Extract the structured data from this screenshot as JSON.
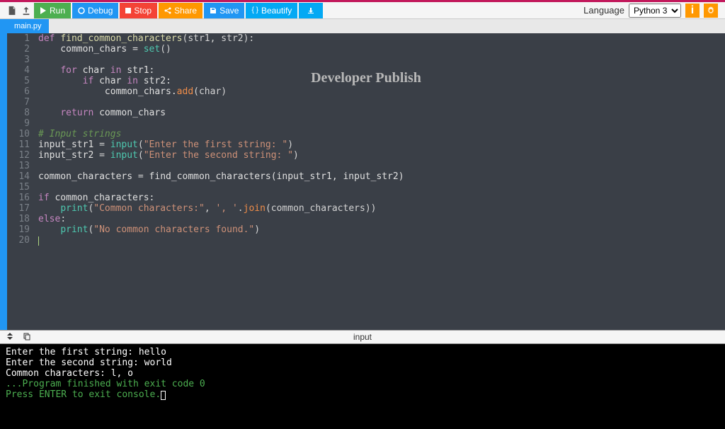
{
  "toolbar": {
    "run": "Run",
    "debug": "Debug",
    "stop": "Stop",
    "share": "Share",
    "save": "Save",
    "beautify": "Beautify"
  },
  "language": {
    "label": "Language",
    "selected": "Python 3"
  },
  "tab": {
    "name": "main.py"
  },
  "watermark": "Developer Publish",
  "code": {
    "lines": [
      [
        {
          "t": "def ",
          "c": "kw"
        },
        {
          "t": "find_common_characters",
          "c": "fn"
        },
        {
          "t": "(str1, str2):",
          "c": "op"
        }
      ],
      [
        {
          "t": "    common_chars ",
          "c": "var"
        },
        {
          "t": "=",
          "c": "op"
        },
        {
          "t": " ",
          "c": "op"
        },
        {
          "t": "set",
          "c": "fn2"
        },
        {
          "t": "()",
          "c": "op"
        }
      ],
      [
        {
          "t": "",
          "c": "op"
        }
      ],
      [
        {
          "t": "    ",
          "c": "op"
        },
        {
          "t": "for",
          "c": "kw"
        },
        {
          "t": " char ",
          "c": "var"
        },
        {
          "t": "in",
          "c": "kw"
        },
        {
          "t": " str1:",
          "c": "var"
        }
      ],
      [
        {
          "t": "        ",
          "c": "op"
        },
        {
          "t": "if",
          "c": "kw"
        },
        {
          "t": " char ",
          "c": "var"
        },
        {
          "t": "in",
          "c": "kw"
        },
        {
          "t": " str2:",
          "c": "var"
        }
      ],
      [
        {
          "t": "            common_chars.",
          "c": "var"
        },
        {
          "t": "add",
          "c": "call"
        },
        {
          "t": "(char)",
          "c": "op"
        }
      ],
      [
        {
          "t": "",
          "c": "op"
        }
      ],
      [
        {
          "t": "    ",
          "c": "op"
        },
        {
          "t": "return",
          "c": "kw"
        },
        {
          "t": " common_chars",
          "c": "var"
        }
      ],
      [
        {
          "t": "",
          "c": "op"
        }
      ],
      [
        {
          "t": "# Input strings",
          "c": "cmt"
        }
      ],
      [
        {
          "t": "input_str1 ",
          "c": "var"
        },
        {
          "t": "=",
          "c": "op"
        },
        {
          "t": " ",
          "c": "op"
        },
        {
          "t": "input",
          "c": "fn2"
        },
        {
          "t": "(",
          "c": "op"
        },
        {
          "t": "\"Enter the first string: \"",
          "c": "str"
        },
        {
          "t": ")",
          "c": "op"
        }
      ],
      [
        {
          "t": "input_str2 ",
          "c": "var"
        },
        {
          "t": "=",
          "c": "op"
        },
        {
          "t": " ",
          "c": "op"
        },
        {
          "t": "input",
          "c": "fn2"
        },
        {
          "t": "(",
          "c": "op"
        },
        {
          "t": "\"Enter the second string: \"",
          "c": "str"
        },
        {
          "t": ")",
          "c": "op"
        }
      ],
      [
        {
          "t": "",
          "c": "op"
        }
      ],
      [
        {
          "t": "common_characters ",
          "c": "var"
        },
        {
          "t": "=",
          "c": "op"
        },
        {
          "t": " find_common_characters(input_str1, input_str2)",
          "c": "var"
        }
      ],
      [
        {
          "t": "",
          "c": "op"
        }
      ],
      [
        {
          "t": "if",
          "c": "kw"
        },
        {
          "t": " common_characters:",
          "c": "var"
        }
      ],
      [
        {
          "t": "    ",
          "c": "op"
        },
        {
          "t": "print",
          "c": "fn2"
        },
        {
          "t": "(",
          "c": "op"
        },
        {
          "t": "\"Common characters:\"",
          "c": "str"
        },
        {
          "t": ", ",
          "c": "op"
        },
        {
          "t": "', '",
          "c": "str"
        },
        {
          "t": ".",
          "c": "op"
        },
        {
          "t": "join",
          "c": "call"
        },
        {
          "t": "(common_characters))",
          "c": "op"
        }
      ],
      [
        {
          "t": "else",
          "c": "kw"
        },
        {
          "t": ":",
          "c": "op"
        }
      ],
      [
        {
          "t": "    ",
          "c": "op"
        },
        {
          "t": "print",
          "c": "fn2"
        },
        {
          "t": "(",
          "c": "op"
        },
        {
          "t": "\"No common characters found.\"",
          "c": "str"
        },
        {
          "t": ")",
          "c": "op"
        }
      ],
      [
        {
          "t": "",
          "c": "op"
        }
      ]
    ]
  },
  "console_label": "input",
  "console": {
    "lines": [
      {
        "text": "Enter the first string: hello",
        "class": ""
      },
      {
        "text": "Enter the second string: world",
        "class": ""
      },
      {
        "text": "Common characters: l, o",
        "class": ""
      },
      {
        "text": "",
        "class": ""
      },
      {
        "text": "",
        "class": ""
      },
      {
        "text": "...Program finished with exit code 0",
        "class": "console-green"
      },
      {
        "text": "Press ENTER to exit console.",
        "class": "console-green",
        "cursor": true
      }
    ]
  }
}
